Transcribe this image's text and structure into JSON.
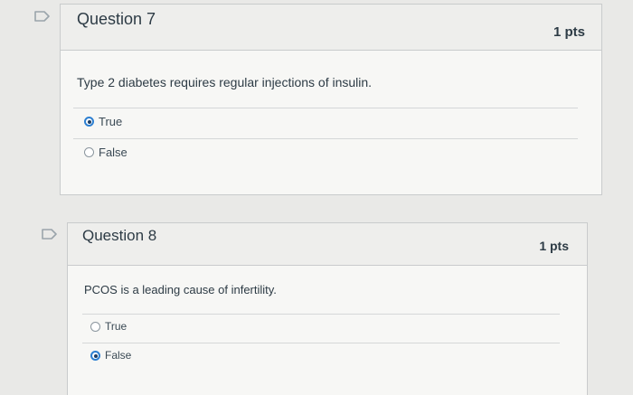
{
  "questions": [
    {
      "title": "Question 7",
      "points": "1 pts",
      "text": "Type 2 diabetes requires regular injections of insulin.",
      "answers": [
        {
          "label": "True",
          "selected": true
        },
        {
          "label": "False",
          "selected": false
        }
      ]
    },
    {
      "title": "Question 8",
      "points": "1 pts",
      "text": "PCOS is a leading cause of infertility.",
      "answers": [
        {
          "label": "True",
          "selected": false
        },
        {
          "label": "False",
          "selected": true
        }
      ]
    }
  ],
  "icons": {
    "flag": "flag-outline-icon"
  },
  "colors": {
    "selected_radio": "#2d7fd1",
    "border": "#c9cbcc",
    "header_bg": "#eeeeec"
  }
}
